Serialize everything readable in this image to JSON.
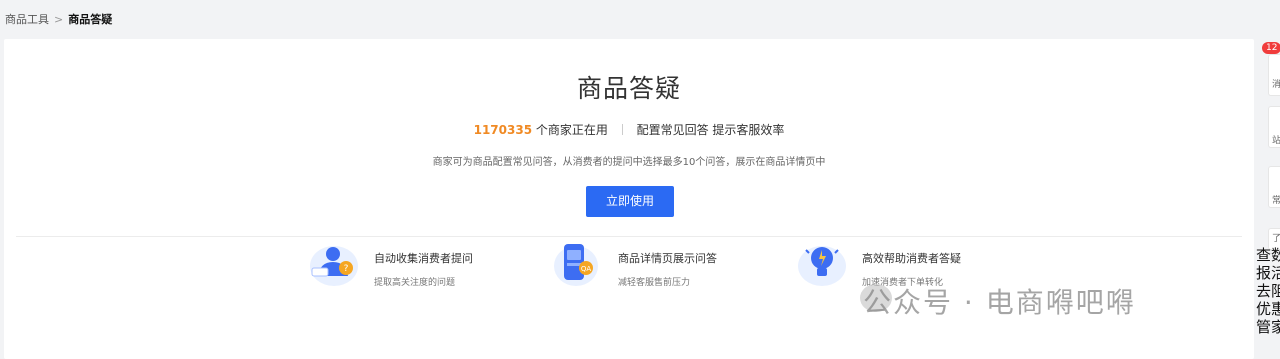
{
  "breadcrumb": {
    "parent": "商品工具",
    "separator": ">",
    "current": "商品答疑"
  },
  "hero": {
    "title": "商品答疑",
    "merchant_count": "1170335",
    "merchant_suffix": "个商家正在用",
    "tagline": "配置常见回答 提示客服效率",
    "description": "商家可为商品配置常见问答，从消费者的提问中选择最多10个问答，展示在商品详情页中",
    "cta_label": "立即使用"
  },
  "features": [
    {
      "title": "自动收集消费者提问",
      "subtitle": "提取高关注度的问题",
      "icon": "user-question-icon"
    },
    {
      "title": "商品详情页展示问答",
      "subtitle": "减轻客服售前压力",
      "icon": "phone-qa-icon"
    },
    {
      "title": "高效帮助消费者答疑",
      "subtitle": "加速消费者下单转化",
      "icon": "lightbulb-icon"
    }
  ],
  "watermark": "公众号 · 电商嘚吧嘚",
  "right_rail": {
    "badge": "12",
    "items": [
      "消",
      "站",
      "常",
      "了"
    ]
  },
  "cutoff_text": [
    "查数",
    "报活",
    "去阻",
    "优惠",
    "管家"
  ],
  "colors": {
    "accent": "#2b6af3",
    "count": "#f08a24",
    "badge": "#f03c3c"
  }
}
